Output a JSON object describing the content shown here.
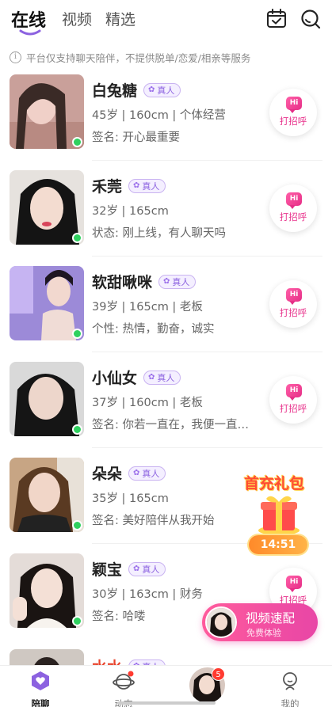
{
  "header": {
    "tabs": [
      {
        "label": "在线",
        "active": true
      },
      {
        "label": "视频",
        "active": false
      },
      {
        "label": "精选",
        "active": false
      }
    ],
    "icons": [
      "calendar-check-icon",
      "search-icon"
    ],
    "accent_color": "#8c62e0"
  },
  "notice": {
    "icon": "info-icon",
    "text": "平台仅支持聊天陪伴，不提供脱单/恋爱/相亲等服务"
  },
  "users": [
    {
      "name": "白兔糖",
      "badge": "真人",
      "info": "45岁 | 160cm | 个体经营",
      "sign": "签名: 开心最重要",
      "online": true,
      "action": "打招呼",
      "action_icon_text": "Hi"
    },
    {
      "name": "禾莞",
      "badge": "真人",
      "info": "32岁 | 165cm",
      "sign": "状态: 刚上线，有人聊天吗",
      "online": true,
      "action": "打招呼",
      "action_icon_text": "Hi"
    },
    {
      "name": "软甜啾咪",
      "badge": "真人",
      "info": "39岁 | 165cm | 老板",
      "sign": "个性: 热情，勤奋，诚实",
      "online": true,
      "action": "打招呼",
      "action_icon_text": "Hi"
    },
    {
      "name": "小仙女",
      "badge": "真人",
      "info": "37岁 | 160cm | 老板",
      "sign": "签名: 你若一直在，我便一直…",
      "online": true,
      "action": "打招呼",
      "action_icon_text": "Hi"
    },
    {
      "name": "朵朵",
      "badge": "真人",
      "info": "35岁 | 165cm",
      "sign": "签名: 美好陪伴从我开始",
      "online": true,
      "action": "打招呼",
      "action_icon_text": "Hi"
    },
    {
      "name": "颖宝",
      "badge": "真人",
      "info": "30岁 | 163cm | 财务",
      "sign": "签名: 哈喽",
      "online": true,
      "action": "打招呼",
      "action_icon_text": "Hi"
    },
    {
      "name": "水水",
      "badge": "真人",
      "info": "",
      "sign": "",
      "online": false,
      "action": "",
      "action_icon_text": ""
    }
  ],
  "promo": {
    "title": "首充礼包",
    "timer": "14:51"
  },
  "video_match": {
    "title": "视频速配",
    "subtitle": "免费体验"
  },
  "bottom_nav": [
    {
      "label": "陪聊",
      "icon": "chat-heart-icon",
      "active": true
    },
    {
      "label": "动态",
      "icon": "planet-icon",
      "active": false,
      "dot": true
    },
    {
      "label": "",
      "icon": "avatar-center",
      "badge": "5"
    },
    {
      "label": "我的",
      "icon": "profile-icon",
      "active": false
    }
  ]
}
